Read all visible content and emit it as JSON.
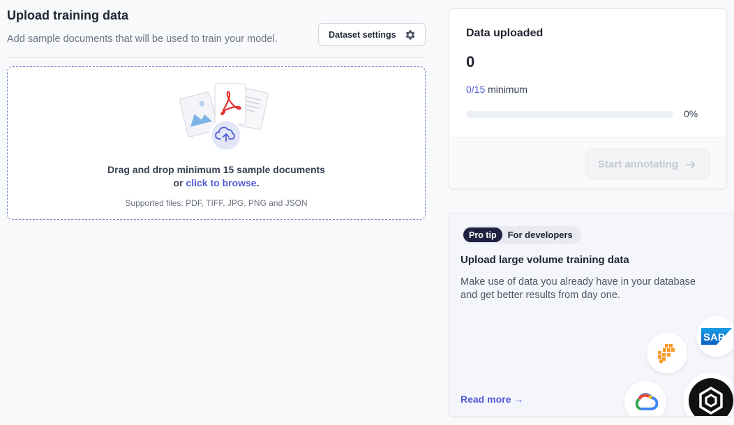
{
  "header": {
    "title": "Upload training data",
    "subtitle": "Add sample documents that will be used to train your model.",
    "settings_label": "Dataset settings"
  },
  "dropzone": {
    "line1": "Drag and drop minimum 15 sample documents",
    "line2_prefix": "or ",
    "line2_link": "click to browse",
    "line2_suffix": ".",
    "hint": "Supported files: PDF, TIFF, JPG, PNG and JSON"
  },
  "upload_card": {
    "title": "Data uploaded",
    "count": "0",
    "min_fraction": "0/15",
    "min_label": " minimum",
    "progress_percent_label": "0%",
    "progress_value": 0,
    "start_label": "Start annotating"
  },
  "tip_card": {
    "badge_primary": "Pro tip",
    "badge_secondary": "For developers",
    "title": "Upload large volume training data",
    "description": "Make use of data you already have in your database and get better results from day one.",
    "read_more": "Read more →",
    "sap_text": "SAP"
  },
  "colors": {
    "accent": "#4f5bd5",
    "badge_dark": "#1e2140"
  }
}
